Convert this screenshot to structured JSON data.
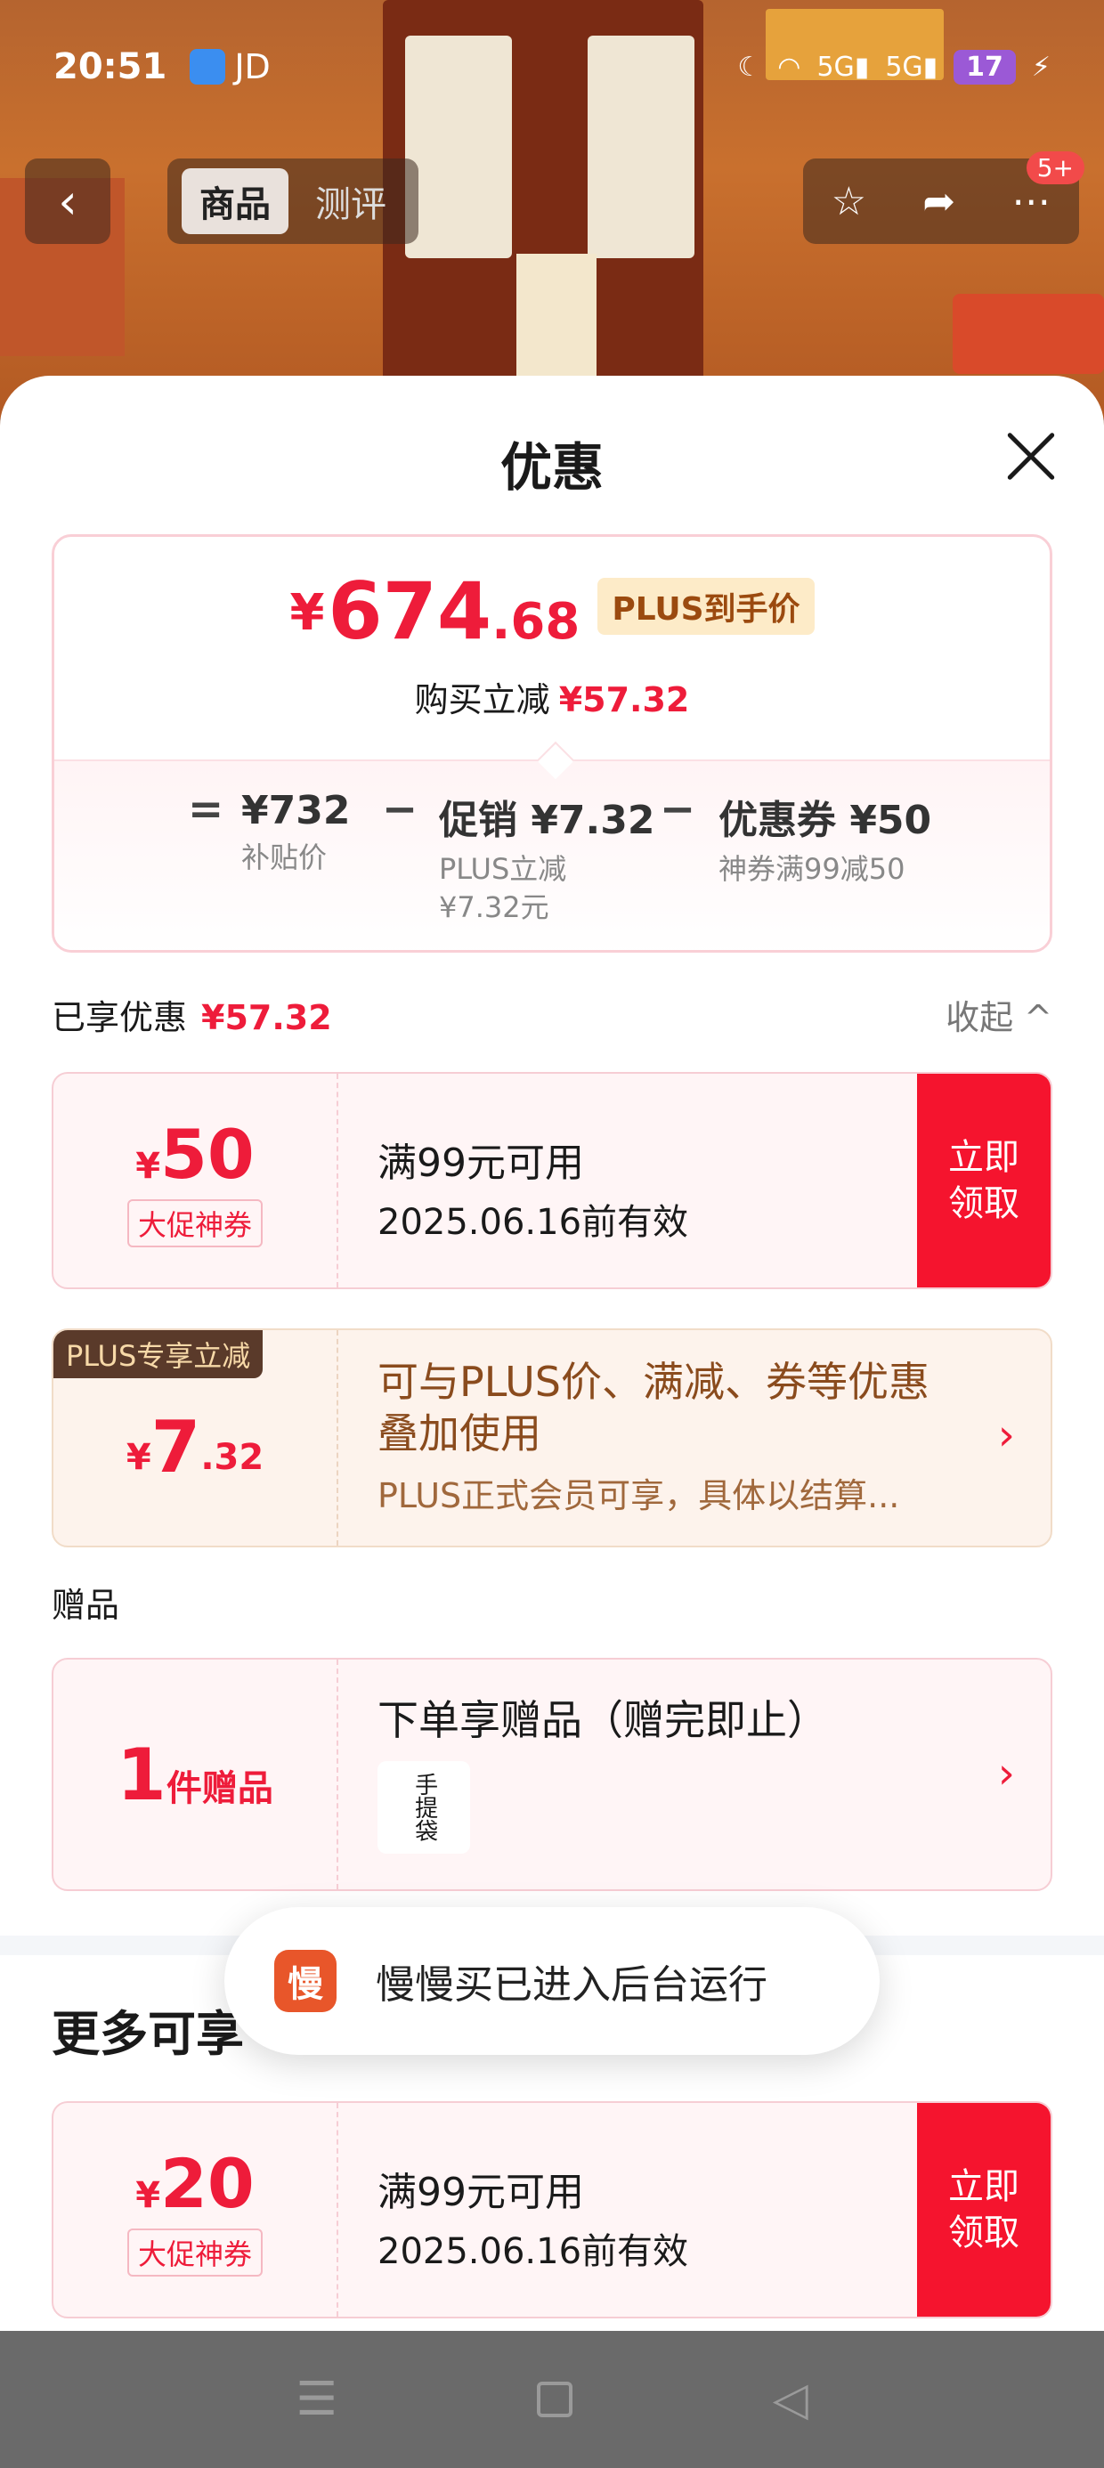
{
  "status_bar": {
    "time": "20:51",
    "app_label": "JD",
    "network": "5G",
    "network2": "5G",
    "battery": "17"
  },
  "nav": {
    "tabs": [
      "商品",
      "测评"
    ],
    "badge": "5+"
  },
  "sheet": {
    "title": "优惠"
  },
  "price": {
    "yen": "¥",
    "int": "674",
    "dec": ".68",
    "tag": "PLUS到手价",
    "reduce_label": "购买立减",
    "reduce_value": "¥57.32",
    "formula": {
      "eq": "=",
      "base_value": "¥732",
      "base_label": "补贴价",
      "minus1": "−",
      "promo_value": "促销 ¥7.32",
      "promo_label1": "PLUS立减",
      "promo_label2": "¥7.32元",
      "minus2": "−",
      "coupon_value": "优惠券 ¥50",
      "coupon_label": "神券满99减50"
    }
  },
  "enjoyed": {
    "label": "已享优惠",
    "value": "¥57.32",
    "collapse": "收起 ^"
  },
  "coupon1": {
    "yen": "¥",
    "amount": "50",
    "tag": "大促神券",
    "line1": "满99元可用",
    "line2": "2025.06.16前有效",
    "button": "立即\n领取"
  },
  "plus": {
    "ribbon": "PLUS专享立减",
    "yen": "¥",
    "int": "7",
    "dec": ".32",
    "line1": "可与PLUS价、满减、券等优惠叠加使用",
    "line2": "PLUS正式会员可享，具体以结算...",
    "chevron": "›"
  },
  "gift": {
    "section": "赠品",
    "count": "1",
    "unit": "件赠品",
    "text": "下单享赠品（赠完即止）",
    "thumb": "手提袋",
    "chevron": "›"
  },
  "more": {
    "title": "更多可享"
  },
  "coupon2": {
    "yen": "¥",
    "amount": "20",
    "tag": "大促神券",
    "line1": "满99元可用",
    "line2": "2025.06.16前有效",
    "button": "立即\n领取"
  },
  "toast": {
    "icon": "慢",
    "text": "慢慢买已进入后台运行"
  },
  "colors": {
    "accent": "#ee1c3a",
    "button_red": "#f5142e",
    "plus_brown": "#8a4b1d"
  }
}
